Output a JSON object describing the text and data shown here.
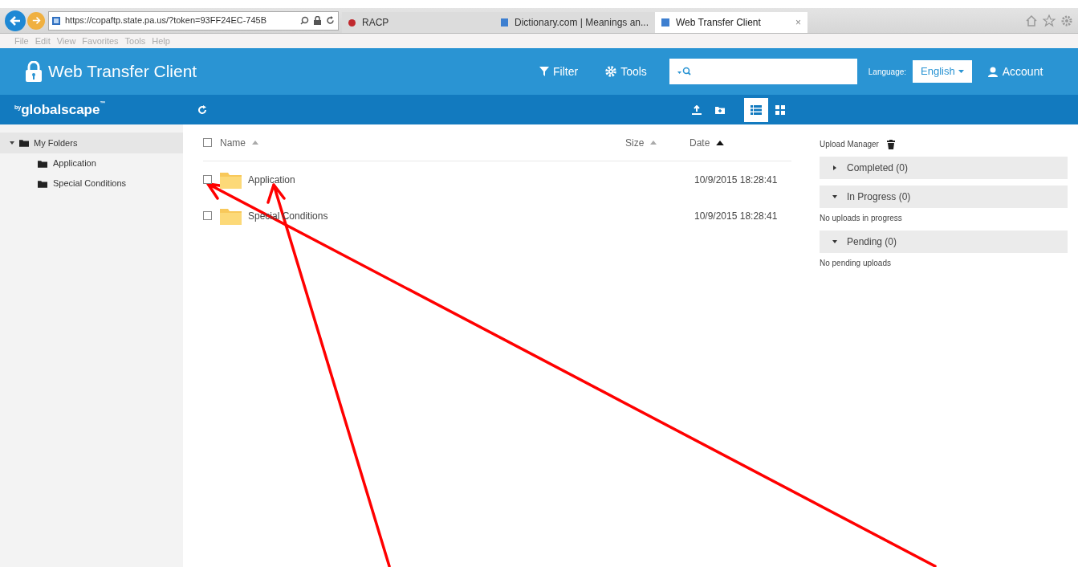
{
  "browser": {
    "address": "https://copaftp.state.pa.us/?token=93FF24EC-745B",
    "tabs": [
      {
        "label": "RACP",
        "selected": false
      },
      {
        "label": "Dictionary.com | Meanings an...",
        "selected": false
      },
      {
        "label": "Web Transfer Client",
        "selected": true,
        "close": "×"
      }
    ],
    "menu": [
      "File",
      "Edit",
      "View",
      "Favorites",
      "Tools",
      "Help"
    ]
  },
  "header": {
    "title": "Web Transfer Client",
    "actions": [
      "Filter",
      "Tools"
    ],
    "language_label": "Language:",
    "language": "English",
    "account": "Account",
    "brand_prefix": "by",
    "brand": "globalscape",
    "brand_mark": "™"
  },
  "view_toggle": [
    {
      "kind": "list",
      "selected": true
    },
    {
      "kind": "grid",
      "selected": false
    }
  ],
  "sidebar": {
    "items": [
      {
        "label": "My Folders",
        "expanded": true,
        "children": [
          {
            "label": "Application"
          },
          {
            "label": "Special Conditions"
          }
        ]
      }
    ]
  },
  "table": {
    "select_all_checked": false,
    "columns": [
      {
        "label": "Name",
        "active": false
      },
      {
        "label": "Size",
        "active": false
      },
      {
        "label": "Date",
        "active": true
      }
    ],
    "rows": [
      {
        "name": "Application",
        "date": "10/9/2015 18:28:41",
        "checked": false
      },
      {
        "name": "Special Conditions",
        "date": "10/9/2015 18:28:41",
        "checked": false
      }
    ]
  },
  "upload_manager": {
    "title": "Upload Manager",
    "sections": [
      {
        "label": "Completed (0)",
        "expanded": false
      },
      {
        "label": "In Progress (0)",
        "expanded": true,
        "message": "No uploads in progress"
      },
      {
        "label": "Pending (0)",
        "expanded": true,
        "message": "No pending uploads"
      }
    ]
  }
}
